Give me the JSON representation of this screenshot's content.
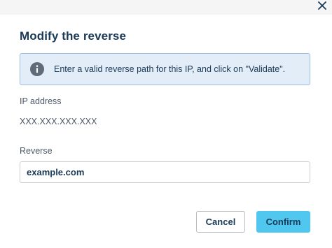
{
  "dialog": {
    "title": "Modify the reverse",
    "close_icon": "close-icon"
  },
  "info": {
    "icon": "info-icon",
    "text": "Enter a valid reverse path for this IP, and click on \"Validate\"."
  },
  "ip": {
    "label": "IP address",
    "value": "XXX.XXX.XXX.XXX"
  },
  "reverse": {
    "label": "Reverse",
    "value": "example.com"
  },
  "actions": {
    "cancel_label": "Cancel",
    "confirm_label": "Confirm"
  },
  "colors": {
    "title": "#1b3a57",
    "info_background": "#e3edf8",
    "info_border": "#9dbde0",
    "confirm_background": "#4fc7ee"
  }
}
